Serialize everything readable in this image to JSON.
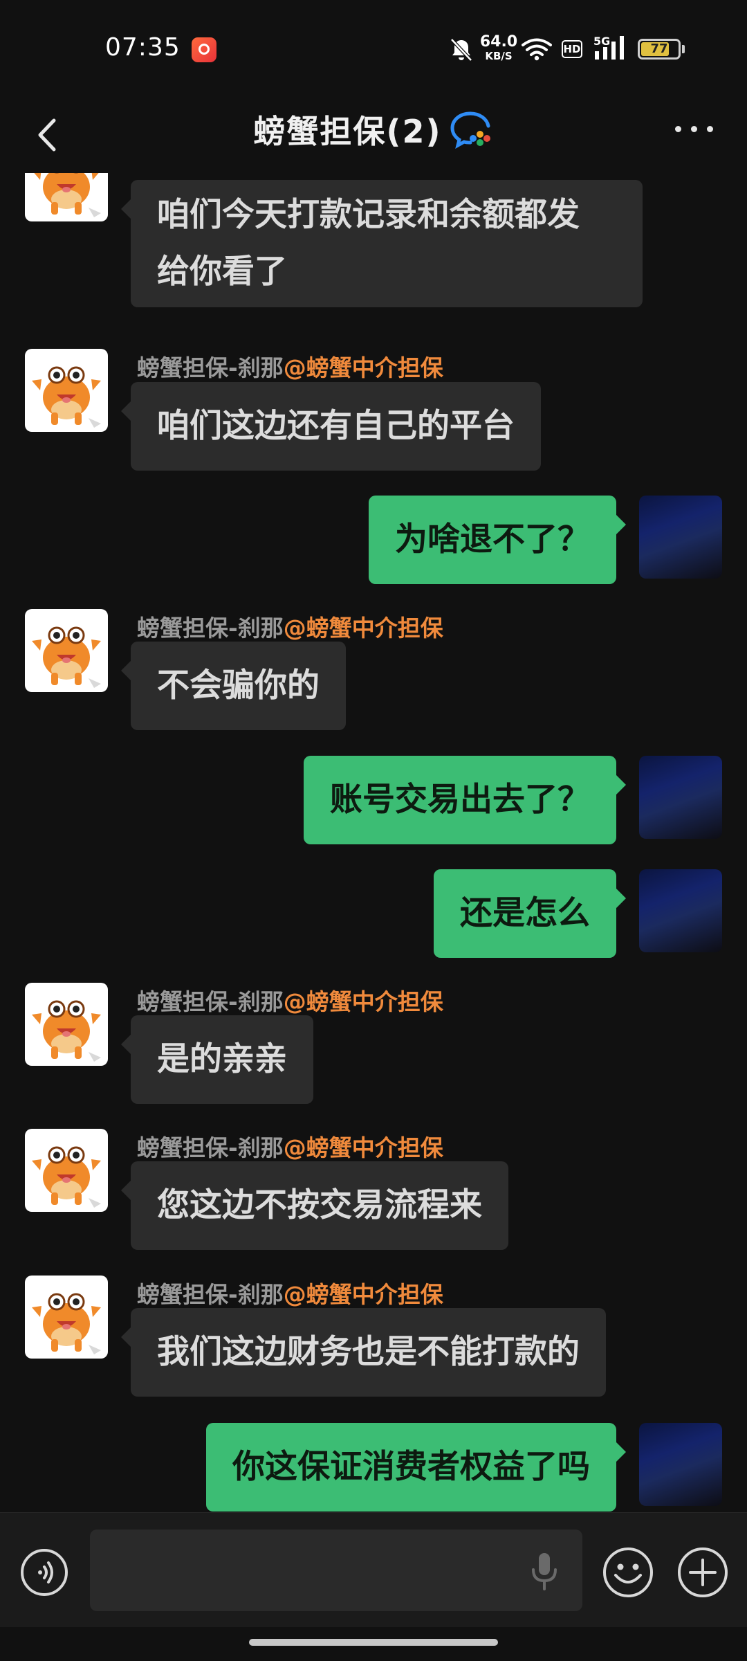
{
  "status_bar": {
    "time": "07:35",
    "net_speed_value": "64.0",
    "net_speed_unit": "KB/S",
    "hd_label": "HD",
    "network_label": "5G",
    "battery_level": "77",
    "battery_fraction": 0.77
  },
  "header": {
    "title": "螃蟹担保(2)"
  },
  "messages": [
    {
      "side": "in",
      "text_lines": [
        "咱们今天打款记录和余额都发",
        "给你看了"
      ]
    },
    {
      "side": "in",
      "sender_name": "螃蟹担保-刹那",
      "sender_tag": "@螃蟹中介担保",
      "text": "咱们这边还有自己的平台"
    },
    {
      "side": "out",
      "text": "为啥退不了？"
    },
    {
      "side": "in",
      "sender_name": "螃蟹担保-刹那",
      "sender_tag": "@螃蟹中介担保",
      "text": "不会骗你的"
    },
    {
      "side": "out",
      "text": "账号交易出去了？"
    },
    {
      "side": "out",
      "text": "还是怎么"
    },
    {
      "side": "in",
      "sender_name": "螃蟹担保-刹那",
      "sender_tag": "@螃蟹中介担保",
      "text": "是的亲亲"
    },
    {
      "side": "in",
      "sender_name": "螃蟹担保-刹那",
      "sender_tag": "@螃蟹中介担保",
      "text": "您这边不按交易流程来"
    },
    {
      "side": "in",
      "sender_name": "螃蟹担保-刹那",
      "sender_tag": "@螃蟹中介担保",
      "text": "我们这边财务也是不能打款的"
    },
    {
      "side": "out",
      "text": "你这保证消费者权益了吗"
    }
  ],
  "colors": {
    "background": "#111111",
    "bubble_in": "#2c2c2c",
    "bubble_out": "#3cbd74",
    "sender_tag": "#f08a3c"
  }
}
